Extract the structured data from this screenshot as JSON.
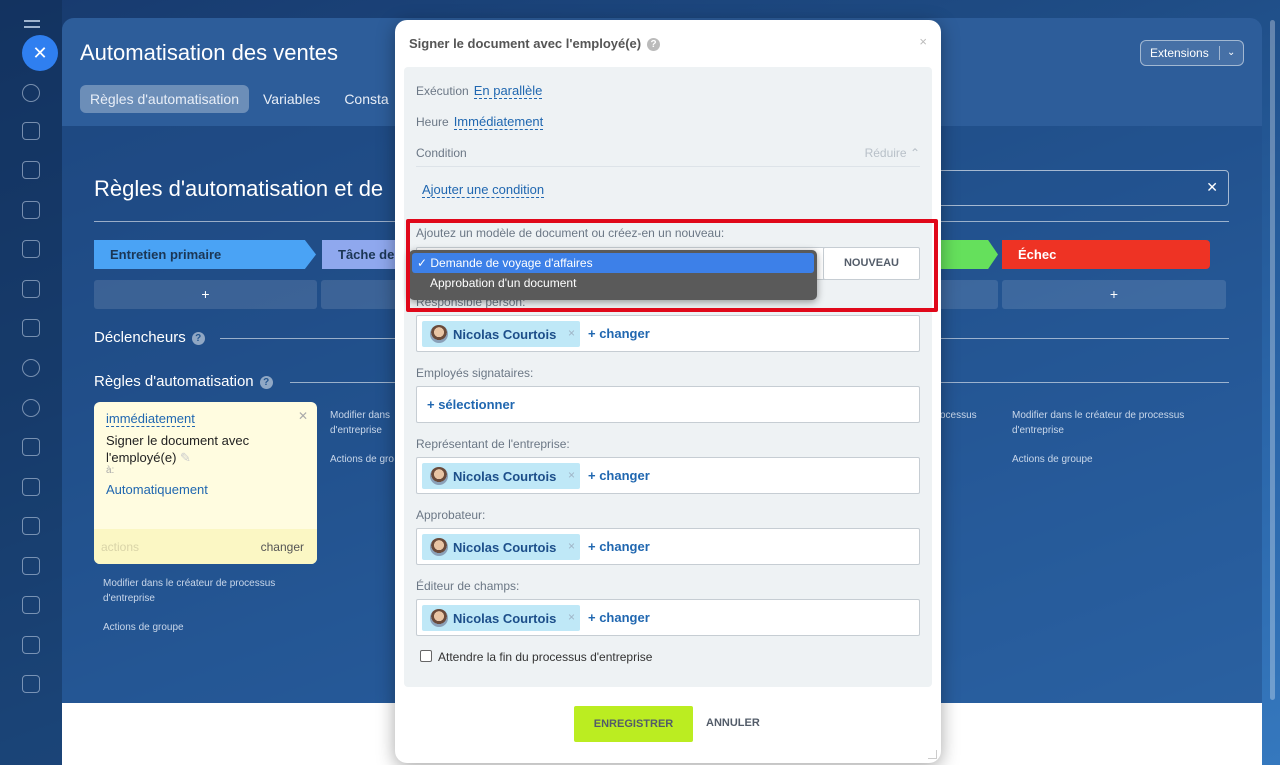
{
  "background": {
    "header_title": "Automatisation des ventes",
    "tabs": [
      {
        "label": "Règles d'automatisation",
        "active": true
      },
      {
        "label": "Variables",
        "active": false
      },
      {
        "label": "Consta",
        "active": false
      }
    ],
    "extensions_label": "Extensions",
    "page_title": "Règles d'automatisation et de",
    "stages": [
      "Entretien primaire",
      "Tâche de",
      "Échec"
    ],
    "plus": "+",
    "triggers_label": "Déclencheurs",
    "rules_label": "Règles d'automatisation",
    "help": "?",
    "rule_card": {
      "when": "immédiatement",
      "title": "Signer le document avec l'employé(e)",
      "to_label": "à:",
      "assignee": "Automatiquement",
      "actions": "actions",
      "change": "changer"
    },
    "links": {
      "modify": "Modifier dans le créateur de processus d'entreprise",
      "group": "Actions de groupe",
      "modify_short": "Modifier dans d'entreprise",
      "group_short": "Actions de gro",
      "modify_right_fragment": "ocessus"
    }
  },
  "modal": {
    "title": "Signer le document avec l'employé(e)",
    "execution_label": "Exécution",
    "execution_value": "En parallèle",
    "time_label": "Heure",
    "time_value": "Immédiatement",
    "condition_label": "Condition",
    "reduce_label": "Réduire",
    "add_condition": "Ajouter une condition",
    "template_label": "Ajoutez un modèle de document ou créez-en un nouveau:",
    "template_options": [
      {
        "label": "✓ Demande de voyage d'affaires",
        "selected": true
      },
      {
        "label": "Approbation d'un document",
        "selected": false
      }
    ],
    "new_button": "NOUVEAU",
    "responsible_label": "Responsible person:",
    "signers_label": "Employés signataires:",
    "select_link": "+ sélectionner",
    "company_rep_label": "Représentant de l'entreprise:",
    "approver_label": "Approbateur:",
    "field_editor_label": "Éditeur de champs:",
    "user_name": "Nicolas Courtois",
    "change_link": "+ changer",
    "wait_checkbox": "Attendre la fin du processus d'entreprise",
    "save_button": "ENREGISTRER",
    "cancel_button": "ANNULER",
    "close": "×",
    "chip_remove": "×"
  },
  "colors": {
    "accent": "#2067b0",
    "save": "#bbed21",
    "highlight": "#e0081a",
    "fail_stage": "#ee3324",
    "primary_stage": "#4aa3f5"
  }
}
